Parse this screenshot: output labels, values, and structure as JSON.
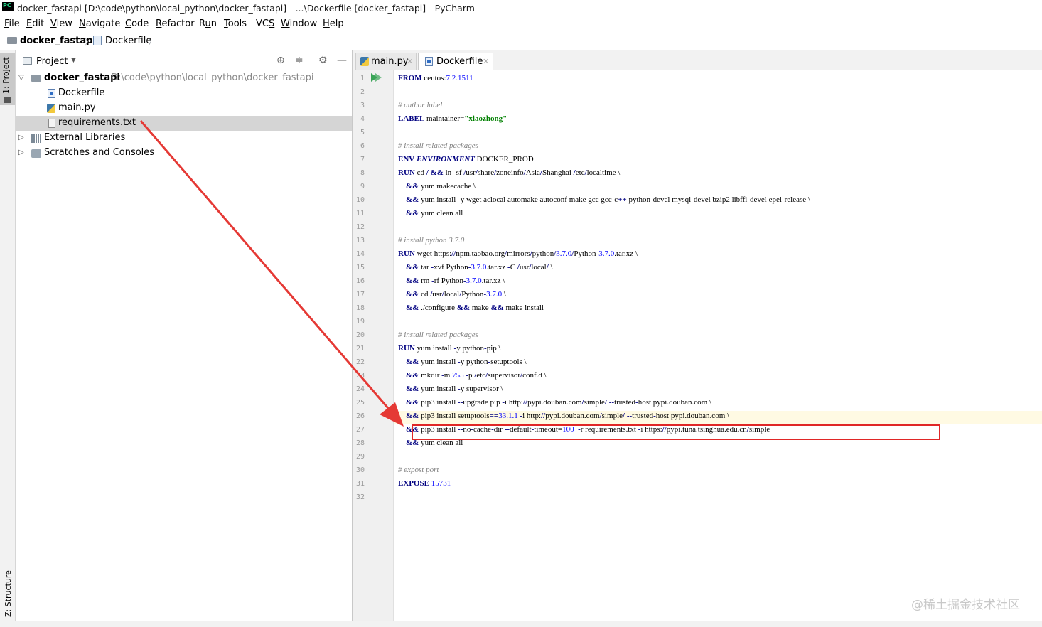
{
  "window": {
    "title": "docker_fastapi [D:\\code\\python\\local_python\\docker_fastapi] - ...\\Dockerfile [docker_fastapi] - PyCharm",
    "logo_text": "PC"
  },
  "menu": [
    {
      "u": "F",
      "rest": "ile"
    },
    {
      "u": "E",
      "rest": "dit"
    },
    {
      "u": "V",
      "rest": "iew"
    },
    {
      "u": "N",
      "rest": "avigate"
    },
    {
      "u": "C",
      "rest": "ode"
    },
    {
      "u": "R",
      "rest": "efactor"
    },
    {
      "pre": "R",
      "u": "u",
      "rest": "n"
    },
    {
      "u": "T",
      "rest": "ools"
    },
    {
      "pre": "VC",
      "u": "S",
      "rest": ""
    },
    {
      "u": "W",
      "rest": "indow"
    },
    {
      "u": "H",
      "rest": "elp"
    }
  ],
  "breadcrumb": {
    "project": "docker_fastapi",
    "file": "Dockerfile"
  },
  "left_stripe": {
    "project_tab": "1: Project",
    "structure_tab": "Z: Structure"
  },
  "project_panel": {
    "header_label": "Project",
    "root_name": "docker_fastapi",
    "root_path": "D:\\code\\python\\local_python\\docker_fastapi",
    "files": [
      "Dockerfile",
      "main.py",
      "requirements.txt"
    ],
    "selected": "requirements.txt",
    "external_libraries": "External Libraries",
    "scratches": "Scratches and Consoles"
  },
  "tabs": [
    {
      "label": "main.py",
      "active": false
    },
    {
      "label": "Dockerfile",
      "active": true
    }
  ],
  "code_lines": [
    [
      [
        "kw",
        "FROM"
      ],
      [
        "t",
        " centos:"
      ],
      [
        "num",
        "7.2.1511"
      ]
    ],
    [],
    [
      [
        "cmt",
        "# author label"
      ]
    ],
    [
      [
        "kw",
        "LABEL"
      ],
      [
        "t",
        " maintainer="
      ],
      [
        "str",
        "\"xiaozhong\""
      ]
    ],
    [],
    [
      [
        "cmt",
        "# install related packages"
      ]
    ],
    [
      [
        "kw",
        "ENV"
      ],
      [
        "t",
        " "
      ],
      [
        "kwi",
        "ENVIRONMENT"
      ],
      [
        "t",
        " DOCKER_PROD"
      ]
    ],
    [
      [
        "kw",
        "RUN"
      ],
      [
        "t",
        " cd "
      ],
      [
        "op",
        "/"
      ],
      [
        "t",
        " "
      ],
      [
        "op",
        "&&"
      ],
      [
        "t",
        " ln "
      ],
      [
        "op",
        "-"
      ],
      [
        "t",
        "sf "
      ],
      [
        "op",
        "/"
      ],
      [
        "t",
        "usr"
      ],
      [
        "op",
        "/"
      ],
      [
        "t",
        "share"
      ],
      [
        "op",
        "/"
      ],
      [
        "t",
        "zoneinfo"
      ],
      [
        "op",
        "/"
      ],
      [
        "t",
        "Asia"
      ],
      [
        "op",
        "/"
      ],
      [
        "t",
        "Shanghai "
      ],
      [
        "op",
        "/"
      ],
      [
        "t",
        "etc"
      ],
      [
        "op",
        "/"
      ],
      [
        "t",
        "localtime \\"
      ]
    ],
    [
      [
        "t",
        "    "
      ],
      [
        "op",
        "&&"
      ],
      [
        "t",
        " yum makecache \\"
      ]
    ],
    [
      [
        "t",
        "    "
      ],
      [
        "op",
        "&&"
      ],
      [
        "t",
        " yum install "
      ],
      [
        "op",
        "-"
      ],
      [
        "t",
        "y wget aclocal automake autoconf make gcc gcc"
      ],
      [
        "op",
        "-"
      ],
      [
        "t",
        "c"
      ],
      [
        "op",
        "++"
      ],
      [
        "t",
        " python"
      ],
      [
        "op",
        "-"
      ],
      [
        "t",
        "devel mysql"
      ],
      [
        "op",
        "-"
      ],
      [
        "t",
        "devel bzip2 libffi"
      ],
      [
        "op",
        "-"
      ],
      [
        "t",
        "devel epel"
      ],
      [
        "op",
        "-"
      ],
      [
        "t",
        "release \\"
      ]
    ],
    [
      [
        "t",
        "    "
      ],
      [
        "op",
        "&&"
      ],
      [
        "t",
        " yum clean all"
      ]
    ],
    [],
    [
      [
        "cmt",
        "# install python 3.7.0"
      ]
    ],
    [
      [
        "kw",
        "RUN"
      ],
      [
        "t",
        " wget https:"
      ],
      [
        "op",
        "//"
      ],
      [
        "t",
        "npm.taobao.org"
      ],
      [
        "op",
        "/"
      ],
      [
        "t",
        "mirrors"
      ],
      [
        "op",
        "/"
      ],
      [
        "t",
        "python"
      ],
      [
        "op",
        "/"
      ],
      [
        "num",
        "3.7.0"
      ],
      [
        "op",
        "/"
      ],
      [
        "t",
        "Python"
      ],
      [
        "op",
        "-"
      ],
      [
        "num",
        "3.7.0"
      ],
      [
        "t",
        ".tar.xz \\"
      ]
    ],
    [
      [
        "t",
        "    "
      ],
      [
        "op",
        "&&"
      ],
      [
        "t",
        " tar "
      ],
      [
        "op",
        "-"
      ],
      [
        "t",
        "xvf Python"
      ],
      [
        "op",
        "-"
      ],
      [
        "num",
        "3.7.0"
      ],
      [
        "t",
        ".tar.xz "
      ],
      [
        "op",
        "-"
      ],
      [
        "t",
        "C "
      ],
      [
        "op",
        "/"
      ],
      [
        "t",
        "usr"
      ],
      [
        "op",
        "/"
      ],
      [
        "t",
        "local"
      ],
      [
        "op",
        "/"
      ],
      [
        "t",
        " \\"
      ]
    ],
    [
      [
        "t",
        "    "
      ],
      [
        "op",
        "&&"
      ],
      [
        "t",
        " rm "
      ],
      [
        "op",
        "-"
      ],
      [
        "t",
        "rf Python"
      ],
      [
        "op",
        "-"
      ],
      [
        "num",
        "3.7.0"
      ],
      [
        "t",
        ".tar.xz \\"
      ]
    ],
    [
      [
        "t",
        "    "
      ],
      [
        "op",
        "&&"
      ],
      [
        "t",
        " cd "
      ],
      [
        "op",
        "/"
      ],
      [
        "t",
        "usr"
      ],
      [
        "op",
        "/"
      ],
      [
        "t",
        "local"
      ],
      [
        "op",
        "/"
      ],
      [
        "t",
        "Python"
      ],
      [
        "op",
        "-"
      ],
      [
        "num",
        "3.7.0"
      ],
      [
        "t",
        " \\"
      ]
    ],
    [
      [
        "t",
        "    "
      ],
      [
        "op",
        "&&"
      ],
      [
        "t",
        " ./configure "
      ],
      [
        "op",
        "&&"
      ],
      [
        "t",
        " make "
      ],
      [
        "op",
        "&&"
      ],
      [
        "t",
        " make install"
      ]
    ],
    [],
    [
      [
        "cmt",
        "# install related packages"
      ]
    ],
    [
      [
        "kw",
        "RUN"
      ],
      [
        "t",
        " yum install "
      ],
      [
        "op",
        "-"
      ],
      [
        "t",
        "y python"
      ],
      [
        "op",
        "-"
      ],
      [
        "t",
        "pip \\"
      ]
    ],
    [
      [
        "t",
        "    "
      ],
      [
        "op",
        "&&"
      ],
      [
        "t",
        " yum install "
      ],
      [
        "op",
        "-"
      ],
      [
        "t",
        "y python"
      ],
      [
        "op",
        "-"
      ],
      [
        "t",
        "setuptools \\"
      ]
    ],
    [
      [
        "t",
        "    "
      ],
      [
        "op",
        "&&"
      ],
      [
        "t",
        " mkdir "
      ],
      [
        "op",
        "-"
      ],
      [
        "t",
        "m "
      ],
      [
        "num",
        "755"
      ],
      [
        "t",
        " "
      ],
      [
        "op",
        "-"
      ],
      [
        "t",
        "p "
      ],
      [
        "op",
        "/"
      ],
      [
        "t",
        "etc"
      ],
      [
        "op",
        "/"
      ],
      [
        "t",
        "supervisor"
      ],
      [
        "op",
        "/"
      ],
      [
        "t",
        "conf.d \\"
      ]
    ],
    [
      [
        "t",
        "    "
      ],
      [
        "op",
        "&&"
      ],
      [
        "t",
        " yum install "
      ],
      [
        "op",
        "-"
      ],
      [
        "t",
        "y supervisor \\"
      ]
    ],
    [
      [
        "t",
        "    "
      ],
      [
        "op",
        "&&"
      ],
      [
        "t",
        " pip3 install "
      ],
      [
        "op",
        "--"
      ],
      [
        "t",
        "upgrade pip "
      ],
      [
        "op",
        "-"
      ],
      [
        "t",
        "i http:"
      ],
      [
        "op",
        "//"
      ],
      [
        "t",
        "pypi.douban.com"
      ],
      [
        "op",
        "/"
      ],
      [
        "t",
        "simple"
      ],
      [
        "op",
        "/"
      ],
      [
        "t",
        " "
      ],
      [
        "op",
        "--"
      ],
      [
        "t",
        "trusted"
      ],
      [
        "op",
        "-"
      ],
      [
        "t",
        "host pypi.douban.com \\"
      ]
    ],
    [
      [
        "t",
        "    "
      ],
      [
        "op",
        "&&"
      ],
      [
        "t",
        " pip3 install setuptools"
      ],
      [
        "op",
        "=="
      ],
      [
        "num",
        "33.1.1"
      ],
      [
        "t",
        " "
      ],
      [
        "op",
        "-"
      ],
      [
        "t",
        "i http:"
      ],
      [
        "op",
        "//"
      ],
      [
        "t",
        "pypi.douban.com"
      ],
      [
        "op",
        "/"
      ],
      [
        "t",
        "simple"
      ],
      [
        "op",
        "/"
      ],
      [
        "t",
        " "
      ],
      [
        "op",
        "--"
      ],
      [
        "t",
        "trusted"
      ],
      [
        "op",
        "-"
      ],
      [
        "t",
        "host pypi.douban.com \\"
      ]
    ],
    [
      [
        "t",
        "    "
      ],
      [
        "op",
        "&&"
      ],
      [
        "t",
        " pip3 install "
      ],
      [
        "op",
        "--"
      ],
      [
        "t",
        "no"
      ],
      [
        "op",
        "-"
      ],
      [
        "t",
        "cache"
      ],
      [
        "op",
        "-"
      ],
      [
        "t",
        "dir "
      ],
      [
        "op",
        "--"
      ],
      [
        "t",
        "default"
      ],
      [
        "op",
        "-"
      ],
      [
        "t",
        "timeout="
      ],
      [
        "num",
        "100"
      ],
      [
        "t",
        "  "
      ],
      [
        "op",
        "-"
      ],
      [
        "t",
        "r requirements.txt "
      ],
      [
        "op",
        "-"
      ],
      [
        "t",
        "i https:"
      ],
      [
        "op",
        "//"
      ],
      [
        "t",
        "pypi.tuna.tsinghua.edu.cn"
      ],
      [
        "op",
        "/"
      ],
      [
        "t",
        "simple"
      ]
    ],
    [
      [
        "t",
        "    "
      ],
      [
        "op",
        "&&"
      ],
      [
        "t",
        " yum clean all"
      ]
    ],
    [],
    [
      [
        "cmt",
        "# expost port"
      ]
    ],
    [
      [
        "kw",
        "EXPOSE"
      ],
      [
        "t",
        " "
      ],
      [
        "num",
        "15731"
      ]
    ],
    []
  ],
  "watermark": "@稀土掘金技术社区",
  "colors": {
    "highlight_box": "#e02727",
    "arrow": "#e53935",
    "keyword": "#000080",
    "number": "#0000ff",
    "string": "#008000",
    "comment": "#808080"
  }
}
